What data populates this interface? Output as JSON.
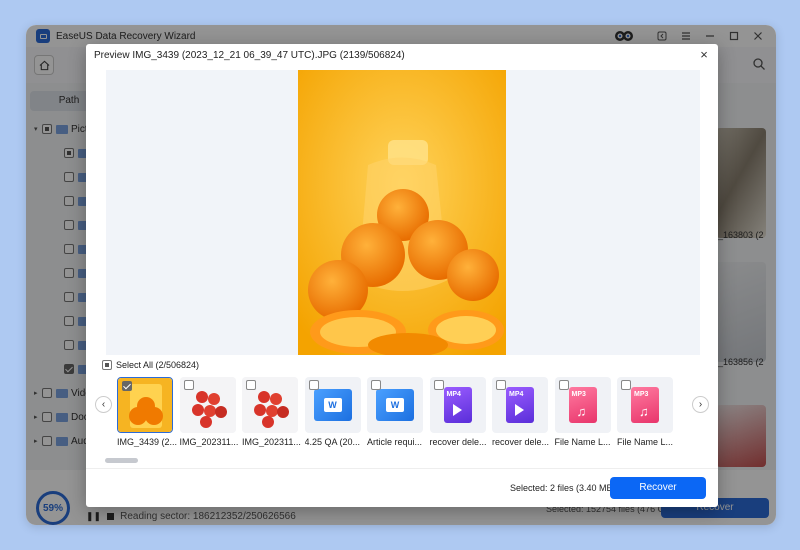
{
  "app": {
    "title": "EaseUS Data Recovery Wizard"
  },
  "background": {
    "path_tab": "Path",
    "tree": [
      {
        "label": "Pictu",
        "level": 0
      },
      {
        "label": "jpg",
        "level": 1
      },
      {
        "label": "png",
        "level": 1
      },
      {
        "label": "jpe",
        "level": 1
      },
      {
        "label": "gif",
        "level": 1
      },
      {
        "label": "bmp",
        "level": 1
      },
      {
        "label": "ico",
        "level": 1
      },
      {
        "label": "cr2",
        "level": 1
      },
      {
        "label": "svg",
        "level": 1
      },
      {
        "label": "web",
        "level": 1
      },
      {
        "label": "wm",
        "level": 1
      },
      {
        "label": "Videc",
        "level": 0
      },
      {
        "label": "Docu",
        "level": 0
      },
      {
        "label": "Audi",
        "level": 0
      }
    ],
    "right_labels": [
      "_163803 (2",
      "_163856 (2"
    ],
    "progress": "59%",
    "reading_sector": "Reading sector: 186212352/250626566",
    "status_text": "Selected: 152754 files (476 GB)",
    "recover_label": "Recover"
  },
  "preview": {
    "title": "Preview IMG_3439 (2023_12_21 06_39_47 UTC).JPG (2139/506824)",
    "close": "×",
    "select_all": "Select All (2/506824)",
    "thumbnails": [
      {
        "name": "IMG_3439 (2...",
        "kind": "orange",
        "checked": true,
        "selected": true
      },
      {
        "name": "IMG_202311...",
        "kind": "tomato",
        "checked": false,
        "selected": false
      },
      {
        "name": "IMG_202311...",
        "kind": "tomato",
        "checked": false,
        "selected": false
      },
      {
        "name": "4.25 QA (20...",
        "kind": "wps",
        "checked": false,
        "selected": false
      },
      {
        "name": "Article requi...",
        "kind": "wps",
        "checked": false,
        "selected": false
      },
      {
        "name": "recover dele...",
        "kind": "mp4",
        "badge": "MP4",
        "checked": false,
        "selected": false
      },
      {
        "name": "recover dele...",
        "kind": "mp4",
        "badge": "MP4",
        "checked": false,
        "selected": false
      },
      {
        "name": "File Name L...",
        "kind": "mp3",
        "badge": "MP3",
        "checked": false,
        "selected": false
      },
      {
        "name": "File Name L...",
        "kind": "mp3",
        "badge": "MP3",
        "checked": false,
        "selected": false
      }
    ],
    "selected_info": "Selected: 2 files (3.40 MB)",
    "recover_label": "Recover"
  },
  "colors": {
    "accent": "#0b67f5",
    "overlay": "#000000"
  }
}
